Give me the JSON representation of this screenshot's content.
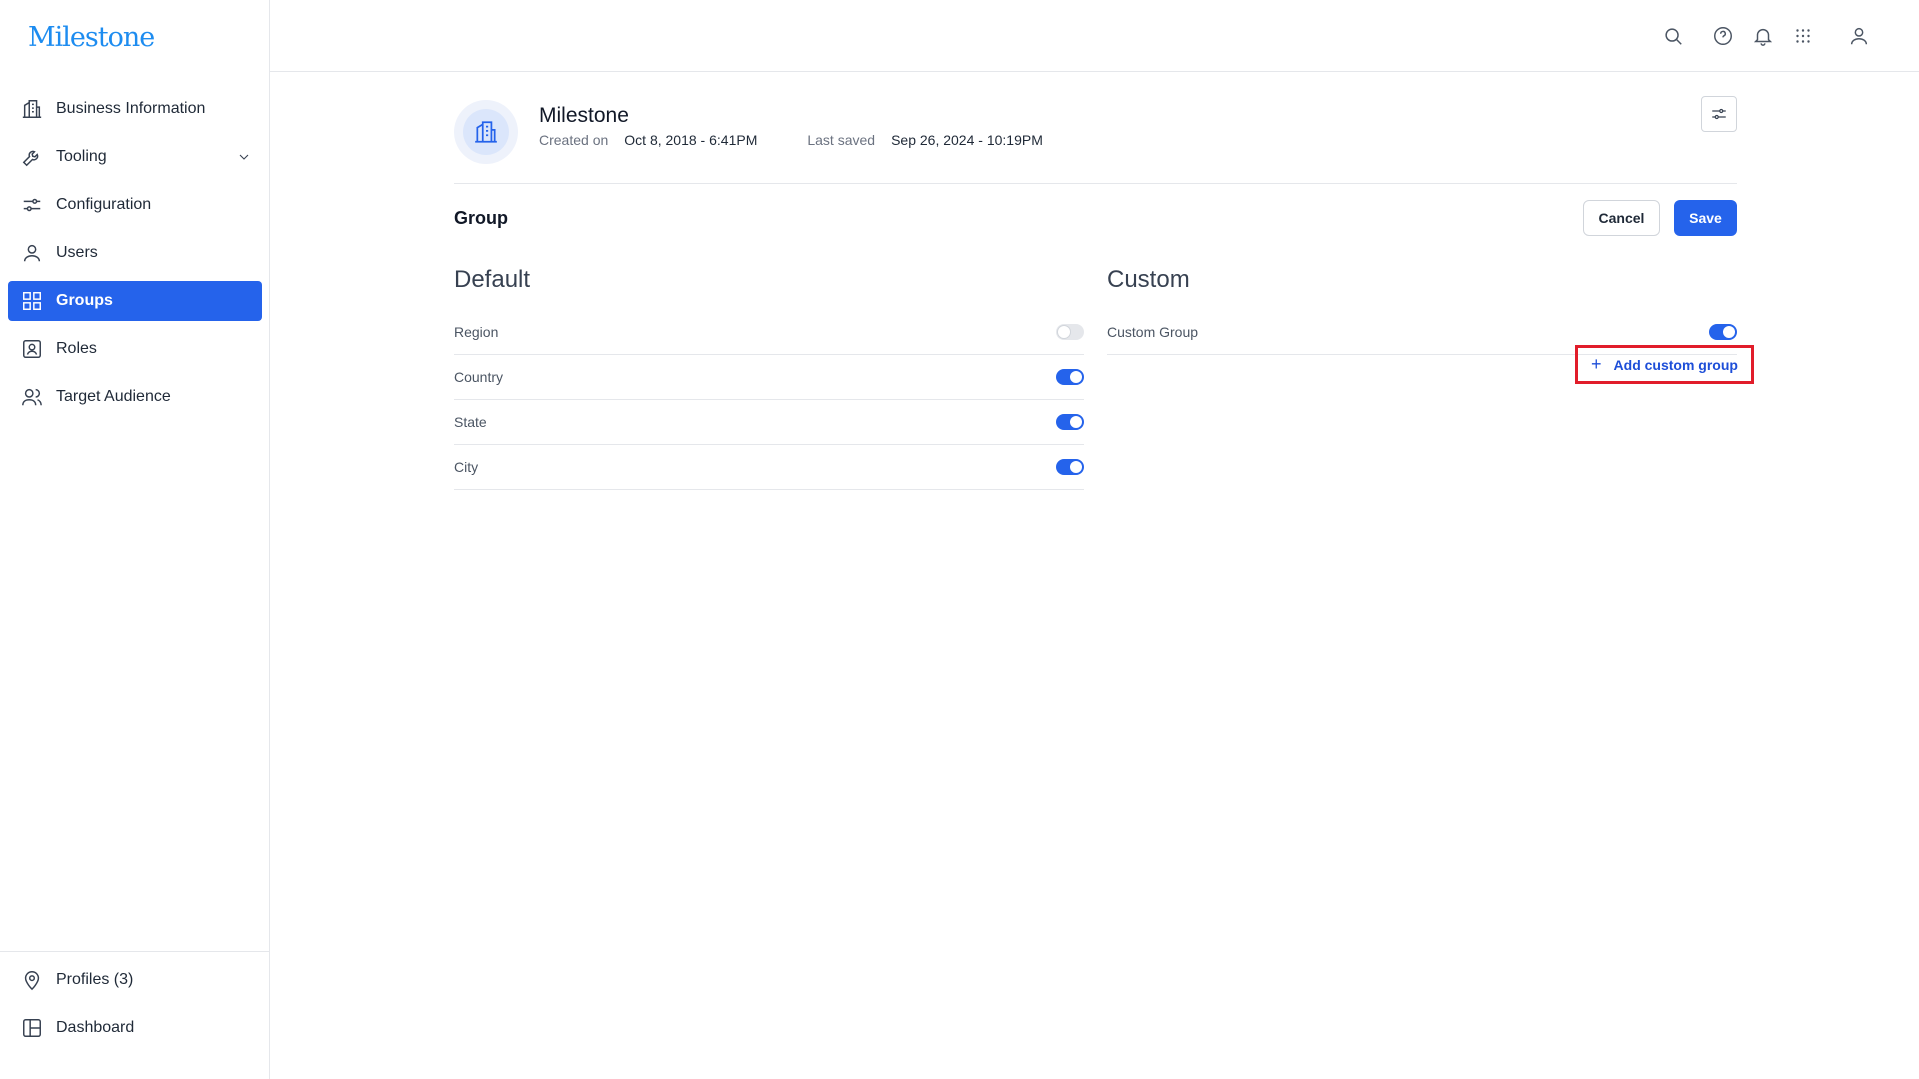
{
  "brand": {
    "logo_text": "Milestone",
    "color": "#1d8cf0"
  },
  "sidebar": {
    "items": [
      {
        "label": "Business Information",
        "icon": "building-icon"
      },
      {
        "label": "Tooling",
        "icon": "wrench-icon"
      },
      {
        "label": "Configuration",
        "icon": "sliders-icon"
      },
      {
        "label": "Users",
        "icon": "user-icon"
      },
      {
        "label": "Groups",
        "icon": "grid-icon",
        "active": true
      },
      {
        "label": "Roles",
        "icon": "id-badge-icon"
      },
      {
        "label": "Target Audience",
        "icon": "users-icon"
      }
    ],
    "bottom": [
      {
        "label": "Profiles (3)",
        "icon": "location-pin-icon"
      },
      {
        "label": "Dashboard",
        "icon": "layout-icon"
      }
    ]
  },
  "header": {
    "business_name": "Milestone",
    "created_label": "Created on",
    "created_value": "Oct 8, 2018 - 6:41PM",
    "saved_label": "Last saved",
    "saved_value": "Sep 26, 2024 - 10:19PM"
  },
  "section": {
    "title": "Group",
    "cancel_label": "Cancel",
    "save_label": "Save"
  },
  "default_col": {
    "title": "Default",
    "rows": [
      {
        "label": "Region",
        "enabled": false
      },
      {
        "label": "Country",
        "enabled": true
      },
      {
        "label": "State",
        "enabled": true
      },
      {
        "label": "City",
        "enabled": true
      }
    ]
  },
  "custom_col": {
    "title": "Custom",
    "rows": [
      {
        "label": "Custom Group",
        "enabled": true
      }
    ],
    "add_label": "Add custom group"
  },
  "colors": {
    "accent": "#2563eb",
    "highlight": "#e11d2a"
  }
}
